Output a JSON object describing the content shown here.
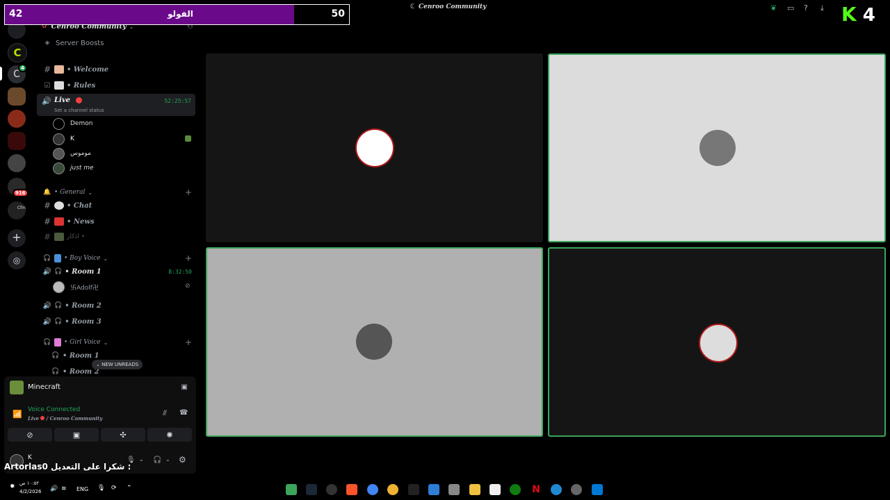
{
  "overlay": {
    "left_count": "42",
    "label": "الفولو",
    "right_count": "50",
    "progress": 0.84,
    "logo_letter": "K",
    "logo_number": "4",
    "caption_name": "Artorlas0",
    "caption_text": "شكرا على التعديل :"
  },
  "window": {
    "title": "Cenroo Community"
  },
  "server": {
    "name": "Cenroo Community",
    "boosts": "Server Boosts"
  },
  "channels": {
    "welcome": "• Welcome",
    "rules": "• Rules",
    "live": {
      "name": "Live",
      "status": "Set a channel status",
      "timer": "52:25:57"
    },
    "live_users": [
      "Demon",
      "K",
      "موموس",
      "just me"
    ],
    "general_category": "• General",
    "chat": "• Chat",
    "news": "• News",
    "hidden": "اذكار •",
    "boy_voice_category": "• Boy Voice",
    "boy_room1": "• Room 1",
    "boy_room1_timer": "8:32:50",
    "boy_room1_user": "卐Adolf卍",
    "boy_room2": "• Room 2",
    "boy_room3": "• Room 3",
    "girl_voice_category": "• Girl Voice",
    "girl_room1": "• Room 1",
    "girl_room2": "• Room 2",
    "new_unreads": "NEW UNREADS"
  },
  "rail": {
    "badge_1": "4",
    "badge_2": "916",
    "cfm": "Cfm"
  },
  "activity": {
    "game": "Minecraft"
  },
  "voice": {
    "status": "Voice Connected",
    "location_channel": "Live",
    "location_server": "/ Cenroo Community"
  },
  "user": {
    "name": "K"
  },
  "taskbar": {
    "time": "١٠:٥٢ ص",
    "date": "4/2/2026",
    "lang": "ENG"
  },
  "colors": {
    "accent_green": "#23a55a",
    "overlay_purple": "#6a0a8a",
    "tile_border": "#3ba55c"
  }
}
